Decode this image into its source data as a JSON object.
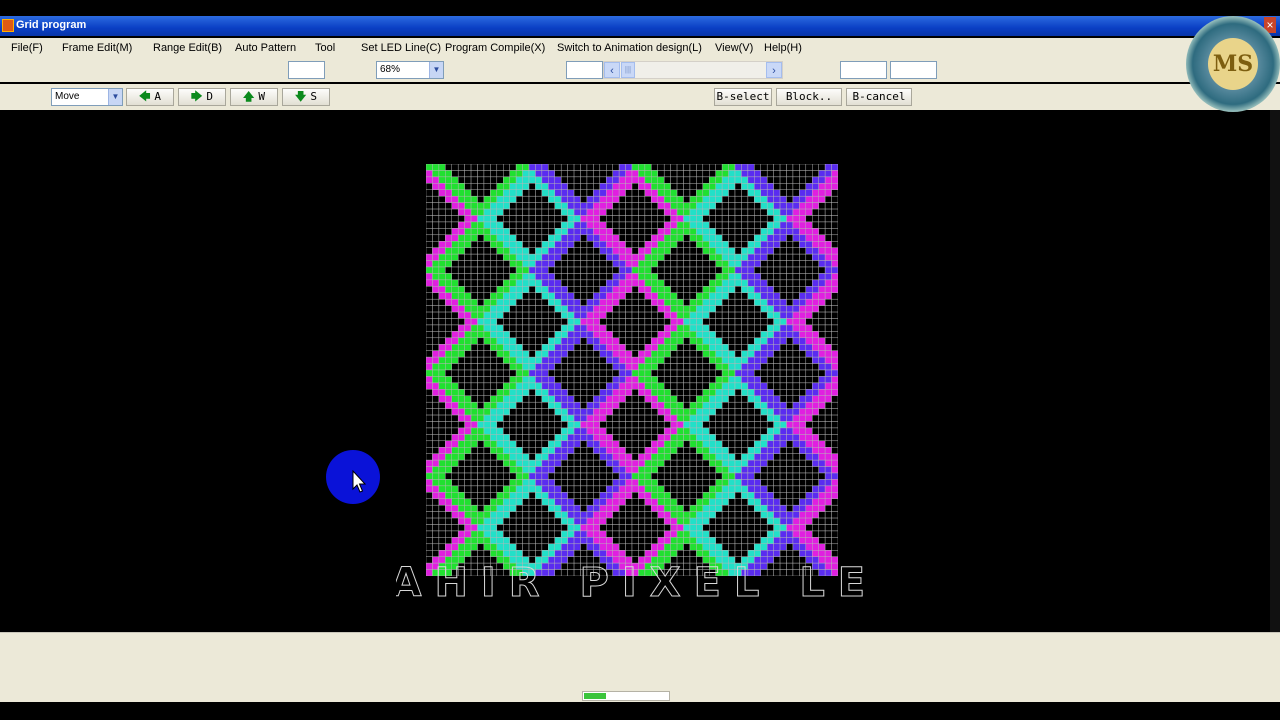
{
  "window": {
    "title": "Grid program",
    "close_glyph": "×"
  },
  "menu": [
    "File(F)",
    "Frame Edit(M)",
    "Range Edit(B)",
    "Auto Pattern",
    "Tool",
    "Set LED Line(C)",
    "Program Compile(X)",
    "Switch to Animation design(L)",
    "View(V)",
    "Help(H)"
  ],
  "toolbar": {
    "zoom_value": "68%",
    "field_a": "",
    "field_b": "",
    "field_c": "",
    "field_d": ""
  },
  "toolbar2": {
    "mode_value": "Move",
    "buttons": {
      "a": "A",
      "d": "D",
      "w": "W",
      "s": "S"
    },
    "select": "B-select",
    "block": "Block..",
    "cancel": "B-cancel"
  },
  "watermark": "MAHIR PIXEL LED",
  "logo_text": "MS",
  "pattern": {
    "columns": 64,
    "rows": 64,
    "colors": [
      "#20e030",
      "#22e0c8",
      "#5a2cf0",
      "#e020e0"
    ],
    "grid_color": "#b8b8b8"
  },
  "status": {
    "progress": 0.25
  },
  "icons": {
    "left": "arrow-left-icon",
    "right": "arrow-right-icon",
    "up": "arrow-up-icon",
    "down": "arrow-down-icon",
    "cursor": "mouse-pointer-icon"
  }
}
